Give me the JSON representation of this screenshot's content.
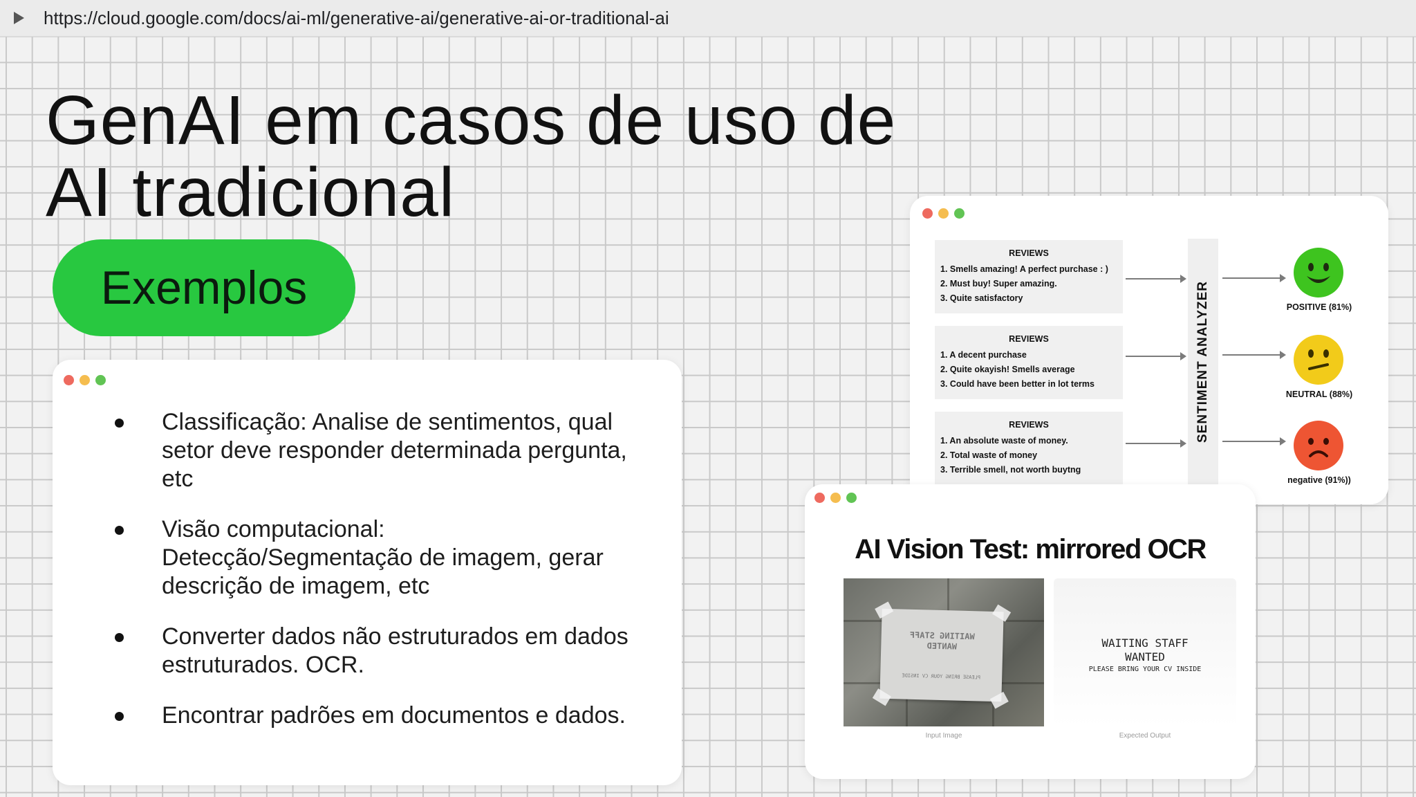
{
  "browser": {
    "url": "https://cloud.google.com/docs/ai-ml/generative-ai/generative-ai-or-traditional-ai"
  },
  "slide": {
    "title_line1": "GenAI em casos de uso de",
    "title_line2": "AI tradicional",
    "badge": "Exemplos",
    "bullets": [
      "Classificação: Analise de sentimentos, qual setor deve responder determinada pergunta, etc",
      "Visão computacional: Detecção/Segmentação de imagem, gerar descrição de imagem, etc",
      "Converter dados não estruturados em dados estruturados. OCR.",
      "Encontrar padrões em documentos e dados."
    ]
  },
  "sentiment": {
    "analyzer_label": "SENTIMENT ANALYZER",
    "groups": [
      {
        "title": "REVIEWS",
        "lines": [
          "1. Smells amazing! A perfect purchase : )",
          "2. Must buy! Super amazing.",
          "3. Quite satisfactory"
        ],
        "result": "POSITIVE (81%)",
        "face": "happy-face-icon",
        "color": "#3ec41f"
      },
      {
        "title": "REVIEWS",
        "lines": [
          "1. A decent purchase",
          "2. Quite okayish! Smells average",
          "3.  Could have been better in lot terms"
        ],
        "result": "NEUTRAL (88%)",
        "face": "neutral-face-icon",
        "color": "#f2cb1a"
      },
      {
        "title": "REVIEWS",
        "lines": [
          "1. An absolute waste of money.",
          "2. Total waste of money",
          "3. Terrible  smell, not worth buytng"
        ],
        "result": "negative (91%))",
        "face": "sad-face-icon",
        "color": "#ee5533"
      }
    ]
  },
  "ocr": {
    "title": "AI Vision Test: mirrored OCR",
    "sign_line1": "WAITING STAFF",
    "sign_line2": "WANTED",
    "sign_line3": "PLEASE BRING YOUR CV INSIDE",
    "output_line1": "WAITING STAFF",
    "output_line2": "WANTED",
    "output_line3": "PLEASE BRING YOUR CV INSIDE",
    "input_caption": "Input Image",
    "output_caption": "Expected Output"
  }
}
